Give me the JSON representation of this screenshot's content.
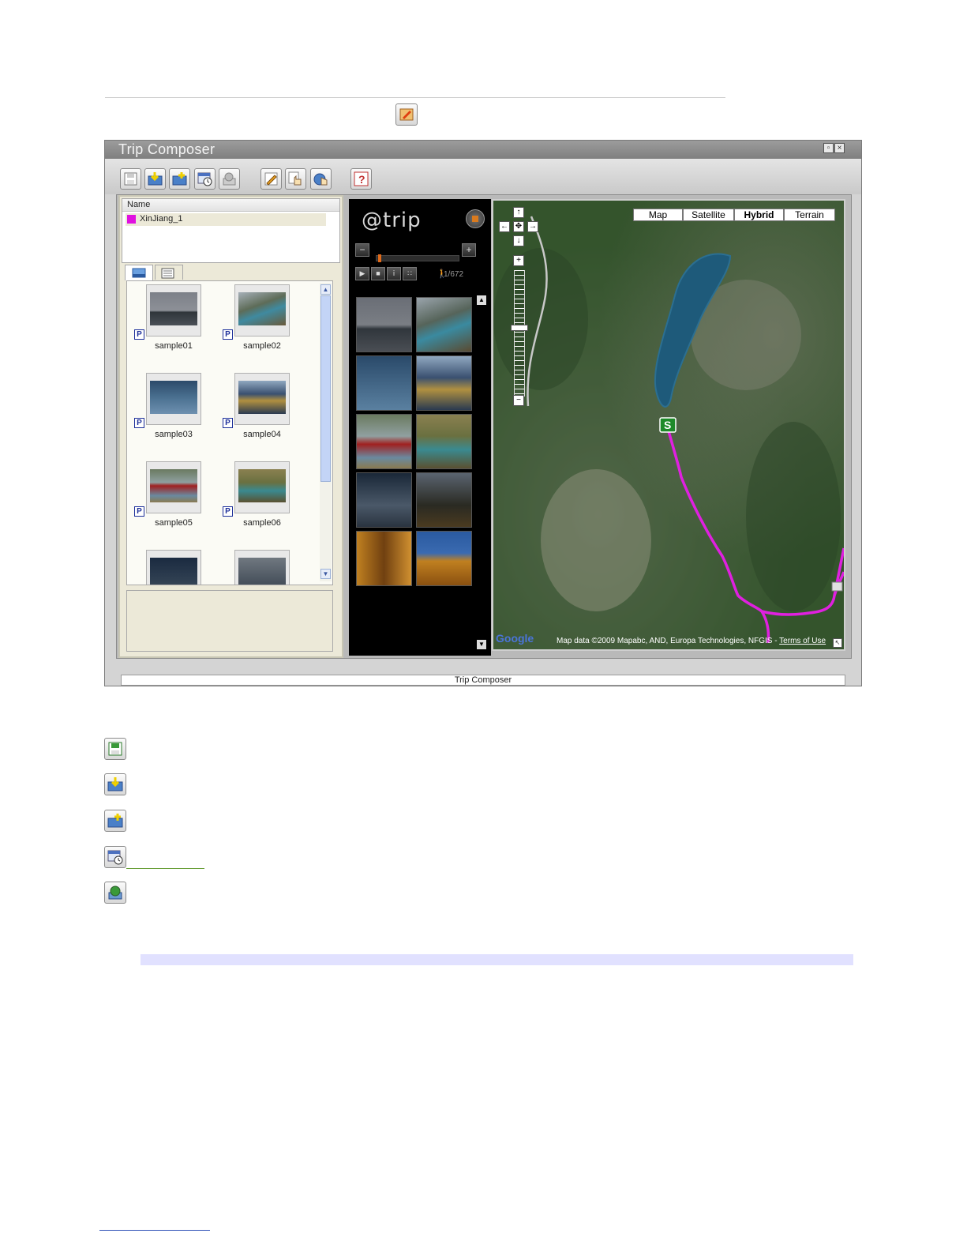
{
  "window": {
    "title": "Trip Composer",
    "status_text": "Trip Composer",
    "controls": [
      "restore-icon",
      "close-icon"
    ]
  },
  "toolbar": {
    "buttons": [
      {
        "name": "save",
        "icon": "save-icon"
      },
      {
        "name": "import",
        "icon": "import-icon"
      },
      {
        "name": "add-photos",
        "icon": "add-photos-icon"
      },
      {
        "name": "timeline",
        "icon": "schedule-icon"
      },
      {
        "name": "publish",
        "icon": "publish-icon"
      },
      {
        "name": "edit",
        "icon": "edit-icon"
      },
      {
        "name": "select",
        "icon": "hand-select-icon"
      },
      {
        "name": "navigate",
        "icon": "navigate-icon"
      },
      {
        "name": "help",
        "icon": "help-icon",
        "label": "?"
      }
    ]
  },
  "trip_list": {
    "column_header": "Name",
    "items": [
      {
        "name": "XinJiang_1",
        "color": "#e010e0"
      }
    ]
  },
  "tabs": [
    {
      "icon": "photo-view-icon",
      "active": true
    },
    {
      "icon": "list-view-icon",
      "active": false
    }
  ],
  "photos": [
    {
      "caption": "sample01",
      "badge": "P"
    },
    {
      "caption": "sample02",
      "badge": "P"
    },
    {
      "caption": "sample03",
      "badge": "P"
    },
    {
      "caption": "sample04",
      "badge": "P"
    },
    {
      "caption": "sample05",
      "badge": "P"
    },
    {
      "caption": "sample06",
      "badge": "P"
    },
    {
      "caption": "",
      "badge": ""
    },
    {
      "caption": "",
      "badge": ""
    }
  ],
  "trip_player": {
    "logo": "@trip",
    "counter": "1/672",
    "minus_label": "−",
    "plus_label": "+",
    "progress_fraction": 0.0015
  },
  "map": {
    "types": [
      "Map",
      "Satellite",
      "Hybrid",
      "Terrain"
    ],
    "selected_type": "Hybrid",
    "start_marker": "S",
    "google_logo": "Google",
    "copyright": "Map data ©2009 Mapabc, AND, Europa Technologies, NFGIS -",
    "terms_link": "Terms of Use",
    "route_color": "#e020e0"
  },
  "colors": {
    "accent_route": "#e020e0",
    "window_title_bg": "#8c8c8c"
  }
}
